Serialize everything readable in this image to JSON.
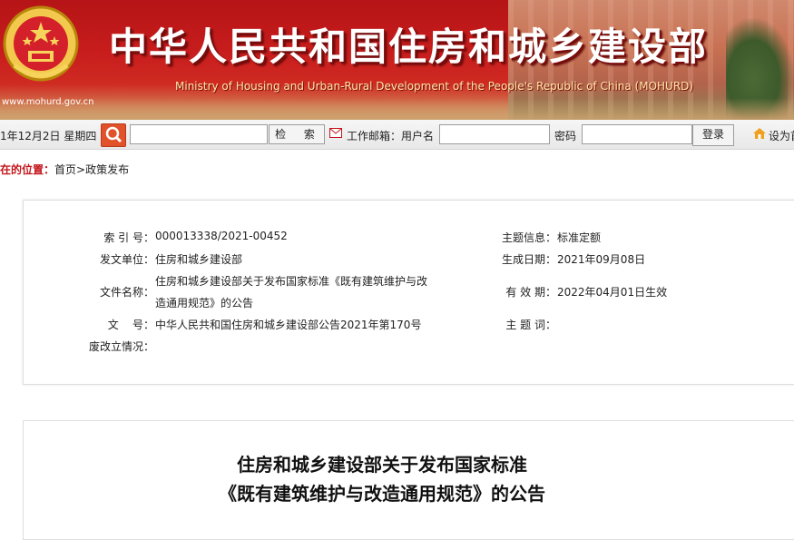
{
  "header": {
    "title": "中华人民共和国住房和城乡建设部",
    "subtitle": "Ministry of Housing and Urban-Rural Development of the People's Republic of China (MOHURD)",
    "url": "www.mohurd.gov.cn",
    "emblem_icon": "national-emblem-icon"
  },
  "toolbar": {
    "date": "1年12月2日 星期四",
    "search_icon": "magnifier-icon",
    "search_value": "",
    "search_button": "检 索",
    "mail_icon": "envelope-icon",
    "mail_label": "工作邮箱：用户名",
    "username_value": "",
    "password_label": "密码",
    "password_value": "",
    "login_button": "登录",
    "home_icon": "home-icon",
    "home_label": "设为首"
  },
  "breadcrumb": {
    "lead": "在的位置：",
    "home": "首页",
    "sep": ">",
    "current": "政策发布"
  },
  "info": {
    "index_label": "索 引 号：",
    "index_value": "000013338/2021-00452",
    "topic_label": "主题信息：",
    "topic_value": "标准定额",
    "issuer_label": "发文单位：",
    "issuer_value": "住房和城乡建设部",
    "created_label": "生成日期：",
    "created_value": "2021年09月08日",
    "filename_label": "文件名称：",
    "filename_line1": "住房和城乡建设部关于发布国家标准《既有建筑维护与改",
    "filename_line2": "造通用规范》的公告",
    "validity_label": "有 效 期：",
    "validity_value": "2022年04月01日生效",
    "docno_label": "文    号：",
    "docno_value": "中华人民共和国住房和城乡建设部公告2021年第170号",
    "keywords_label": "主 题 词：",
    "keywords_value": "",
    "repeal_label": "废改立情况：",
    "repeal_value": ""
  },
  "article": {
    "title_line1": "住房和城乡建设部关于发布国家标准",
    "title_line2": "《既有建筑维护与改造通用规范》的公告"
  },
  "colors": {
    "banner_red": "#c81d1d",
    "breadcrumb_red": "#c4161c",
    "search_orange": "#e2522a"
  }
}
